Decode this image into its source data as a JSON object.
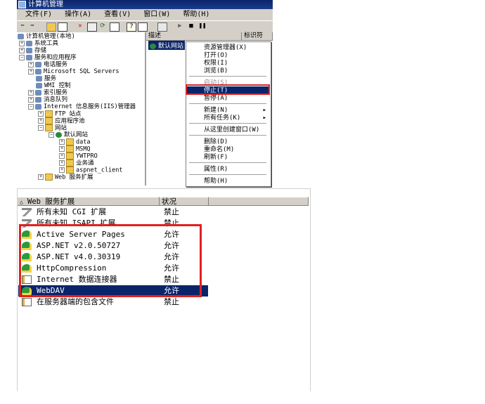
{
  "window": {
    "title": "计算机管理",
    "menus": [
      "文件(F)",
      "操作(A)",
      "查看(V)",
      "窗口(W)",
      "帮助(H)"
    ]
  },
  "tree": {
    "root": "计算机管理(本地)",
    "items": [
      {
        "label": "系统工具",
        "level": 1,
        "icon": "gear-icon"
      },
      {
        "label": "存储",
        "level": 1,
        "icon": "gear-icon"
      },
      {
        "label": "服务和应用程序",
        "level": 1,
        "icon": "gear-icon"
      },
      {
        "label": "电话服务",
        "level": 2,
        "icon": "gear-icon"
      },
      {
        "label": "Microsoft SQL Servers",
        "level": 2,
        "icon": "gear-icon"
      },
      {
        "label": "服务",
        "level": 2,
        "icon": "gear-icon"
      },
      {
        "label": "WMI 控制",
        "level": 2,
        "icon": "gear-icon"
      },
      {
        "label": "索引服务",
        "level": 2,
        "icon": "gear-icon"
      },
      {
        "label": "消息队列",
        "level": 2,
        "icon": "gear-icon"
      },
      {
        "label": "Internet 信息服务(IIS)管理器",
        "level": 2,
        "icon": "gear-icon"
      },
      {
        "label": "FTP 站点",
        "level": 3,
        "icon": "folder-icon"
      },
      {
        "label": "应用程序池",
        "level": 3,
        "icon": "folder-icon"
      },
      {
        "label": "网站",
        "level": 3,
        "icon": "folder-icon"
      },
      {
        "label": "默认网站",
        "level": 4,
        "icon": "globe-icon"
      },
      {
        "label": "data",
        "level": 5,
        "icon": "folder-icon"
      },
      {
        "label": "MSMQ",
        "level": 5,
        "icon": "folder-icon"
      },
      {
        "label": "YWTPRO",
        "level": 5,
        "icon": "folder-icon"
      },
      {
        "label": "业务通",
        "level": 5,
        "icon": "folder-icon"
      },
      {
        "label": "aspnet_client",
        "level": 5,
        "icon": "folder-icon"
      },
      {
        "label": "Web 服务扩展",
        "level": 3,
        "icon": "folder-icon"
      }
    ]
  },
  "right_pane": {
    "col_desc": "描述",
    "col_id": "标识符",
    "site": "默认网站"
  },
  "context_menu": [
    {
      "label": "资源管理器(X)",
      "state": "normal"
    },
    {
      "label": "打开(O)",
      "state": "normal"
    },
    {
      "label": "权限(I)",
      "state": "normal"
    },
    {
      "label": "浏览(B)",
      "state": "normal"
    },
    {
      "sep": true
    },
    {
      "label": "启动(S)",
      "state": "disabled"
    },
    {
      "label": "停止(T)",
      "state": "selected"
    },
    {
      "label": "暂停(A)",
      "state": "normal"
    },
    {
      "sep": true
    },
    {
      "label": "新建(N)",
      "state": "normal",
      "submenu": true
    },
    {
      "label": "所有任务(K)",
      "state": "normal",
      "submenu": true
    },
    {
      "sep": true
    },
    {
      "label": "从这里创建窗口(W)",
      "state": "normal"
    },
    {
      "sep": true
    },
    {
      "label": "删除(D)",
      "state": "normal"
    },
    {
      "label": "重命名(M)",
      "state": "normal"
    },
    {
      "label": "刷新(F)",
      "state": "normal"
    },
    {
      "sep": true
    },
    {
      "label": "属性(R)",
      "state": "normal"
    },
    {
      "sep": true
    },
    {
      "label": "帮助(H)",
      "state": "normal"
    }
  ],
  "extensions": {
    "col_name": "Web 服务扩展",
    "col_status": "状况",
    "rows": [
      {
        "name": "所有未知 CGI 扩展",
        "status": "禁止",
        "icon": "filter-icon"
      },
      {
        "name": "所有未知 ISAPI 扩展",
        "status": "禁止",
        "icon": "filter-icon"
      },
      {
        "name": "Active Server Pages",
        "status": "允许",
        "icon": "extension-icon"
      },
      {
        "name": "ASP.NET v2.0.50727",
        "status": "允许",
        "icon": "extension-icon"
      },
      {
        "name": "ASP.NET v4.0.30319",
        "status": "允许",
        "icon": "extension-icon"
      },
      {
        "name": "HttpCompression",
        "status": "允许",
        "icon": "extension-icon"
      },
      {
        "name": "Internet 数据连接器",
        "status": "禁止",
        "icon": "document-icon"
      },
      {
        "name": "WebDAV",
        "status": "允许",
        "icon": "extension-icon",
        "selected": true
      },
      {
        "name": "在服务器端的包含文件",
        "status": "禁止",
        "icon": "document-icon"
      }
    ]
  }
}
